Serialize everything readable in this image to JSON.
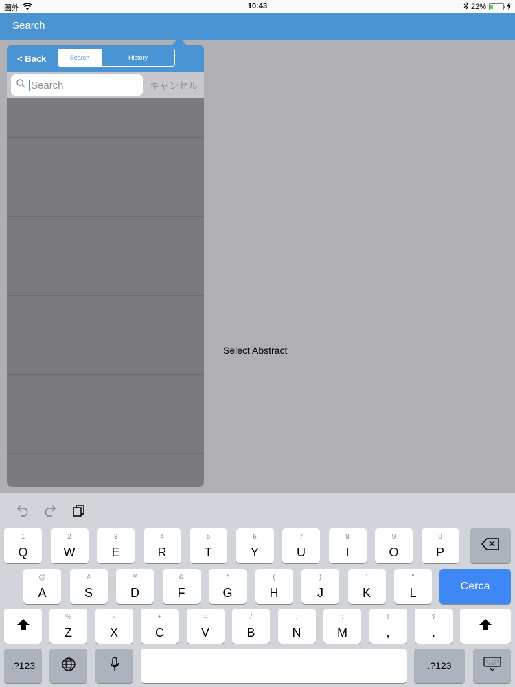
{
  "status_bar": {
    "carrier": "圏外",
    "time": "10:43",
    "battery": "22%",
    "battery_level": 0.22,
    "icons": [
      "wifi-icon",
      "bluetooth-icon",
      "battery-icon",
      "charging-icon"
    ]
  },
  "nav_bar": {
    "title": "Search"
  },
  "popover": {
    "back_label": "< Back",
    "segments": [
      {
        "label": "Search",
        "selected": true
      },
      {
        "label": "History",
        "selected": false
      }
    ],
    "search": {
      "placeholder": "Search",
      "cancel_label": "キャンセル"
    }
  },
  "detail": {
    "placeholder_text": "Select Abstract"
  },
  "keyboard": {
    "toolbar_icons": [
      "undo-icon",
      "redo-icon",
      "paste-icon"
    ],
    "rows": [
      [
        {
          "main": "Q",
          "sub": "1"
        },
        {
          "main": "W",
          "sub": "2"
        },
        {
          "main": "E",
          "sub": "3"
        },
        {
          "main": "R",
          "sub": "4"
        },
        {
          "main": "T",
          "sub": "5"
        },
        {
          "main": "Y",
          "sub": "6"
        },
        {
          "main": "U",
          "sub": "7"
        },
        {
          "main": "I",
          "sub": "8"
        },
        {
          "main": "O",
          "sub": "9"
        },
        {
          "main": "P",
          "sub": "0"
        }
      ],
      [
        {
          "main": "A",
          "sub": "@"
        },
        {
          "main": "S",
          "sub": "#"
        },
        {
          "main": "D",
          "sub": "¥"
        },
        {
          "main": "F",
          "sub": "&"
        },
        {
          "main": "G",
          "sub": "*"
        },
        {
          "main": "H",
          "sub": "("
        },
        {
          "main": "J",
          "sub": ")"
        },
        {
          "main": "K",
          "sub": "'"
        },
        {
          "main": "L",
          "sub": "\""
        }
      ],
      [
        {
          "main": "Z",
          "sub": "%"
        },
        {
          "main": "X",
          "sub": "-"
        },
        {
          "main": "C",
          "sub": "+"
        },
        {
          "main": "V",
          "sub": "="
        },
        {
          "main": "B",
          "sub": "/"
        },
        {
          "main": "N",
          "sub": ";"
        },
        {
          "main": "M",
          "sub": ":"
        },
        {
          "main": ",",
          "sub": "!"
        },
        {
          "main": ".",
          "sub": "?"
        }
      ]
    ],
    "return_label": "Cerca",
    "numbers_label": ".?123",
    "accent": "#3e87f5"
  }
}
